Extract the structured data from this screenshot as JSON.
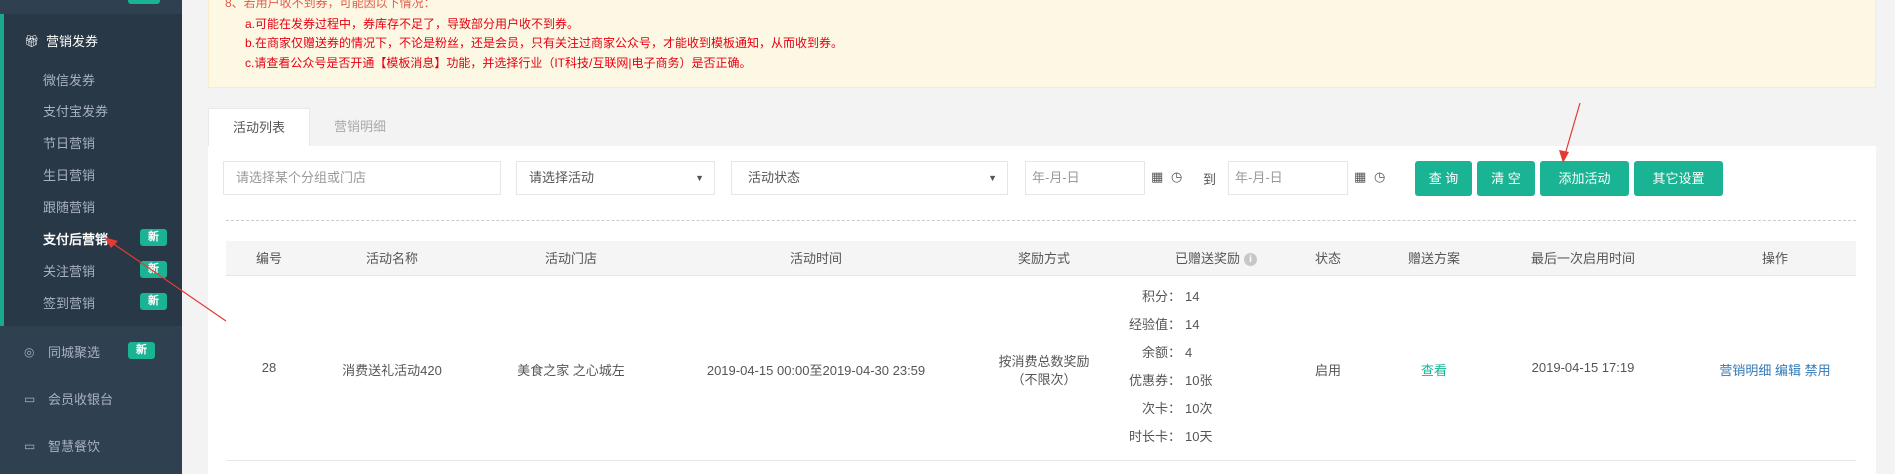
{
  "sidebar": {
    "group_title": "营销发券",
    "sub_items": [
      {
        "label": "微信发券",
        "badge": ""
      },
      {
        "label": "支付宝发券",
        "badge": ""
      },
      {
        "label": "节日营销",
        "badge": ""
      },
      {
        "label": "生日营销",
        "badge": ""
      },
      {
        "label": "跟随营销",
        "badge": ""
      },
      {
        "label": "支付后营销",
        "badge": "新"
      },
      {
        "label": "关注营销",
        "badge": "新"
      },
      {
        "label": "签到营销",
        "badge": "新"
      }
    ],
    "items": [
      {
        "label": "同城聚选",
        "badge": "新"
      },
      {
        "label": "会员收银台",
        "badge": ""
      },
      {
        "label": "智慧餐饮",
        "badge": ""
      }
    ]
  },
  "notice": {
    "line0": "8、若用户收不到券，可能因以下情况：",
    "line1": "a.可能在发券过程中，券库存不足了，导致部分用户收不到券。",
    "line2": "b.在商家仅赠送券的情况下，不论是粉丝，还是会员，只有关注过商家公众号，才能收到模板通知，从而收到券。",
    "line3": "c.请查看公众号是否开通【模板消息】功能，并选择行业（IT科技/互联网|电子商务）是否正确。"
  },
  "tabs": [
    {
      "label": "活动列表",
      "active": true
    },
    {
      "label": "营销明细",
      "active": false
    }
  ],
  "filters": {
    "group_placeholder": "请选择某个分组或门店",
    "activity_select": "请选择活动",
    "status_select": "活动状态",
    "date_from_placeholder": "年-月-日",
    "to_label": "到",
    "date_to_placeholder": "年-月-日"
  },
  "buttons": {
    "query": "查 询",
    "clear": "清 空",
    "add": "添加活动",
    "other": "其它设置"
  },
  "table": {
    "headers": [
      "编号",
      "活动名称",
      "活动门店",
      "活动时间",
      "奖励方式",
      "已赠送奖励",
      "状态",
      "赠送方案",
      "最后一次启用时间",
      "操作"
    ],
    "row": {
      "id": "28",
      "name": "消费送礼活动420",
      "store": "美食之家 之心城左",
      "time": "2019-04-15 00:00至2019-04-30 23:59",
      "reward_type_1": "按消费总数奖励",
      "reward_type_2": "（不限次）",
      "rewards": [
        {
          "k": "积分：",
          "v": "14"
        },
        {
          "k": "经验值：",
          "v": "14"
        },
        {
          "k": "余额：",
          "v": "4"
        },
        {
          "k": "优惠券：",
          "v": "10张"
        },
        {
          "k": "次卡：",
          "v": "10次"
        },
        {
          "k": "时长卡：",
          "v": "10天"
        }
      ],
      "status": "启用",
      "plan": "查看",
      "last_enabled": "2019-04-15 17:19",
      "actions": [
        "营销明细",
        "编辑",
        "禁用"
      ]
    }
  },
  "colors": {
    "sidebar_bg": "#2f4050",
    "accent": "#1ab394",
    "notice_text": "#e60012",
    "arrow": "#e53935"
  }
}
